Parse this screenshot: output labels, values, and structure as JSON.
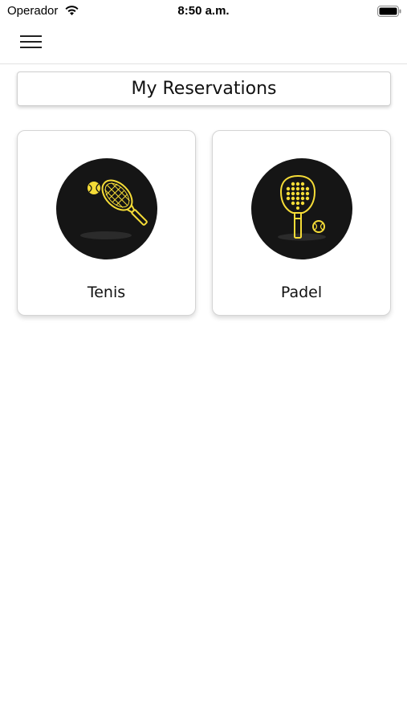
{
  "status_bar": {
    "carrier": "Operador",
    "time": "8:50 a.m.",
    "wifi_icon": "wifi-icon",
    "battery_icon": "battery-full-icon"
  },
  "nav": {
    "menu_icon": "hamburger-menu-icon"
  },
  "page": {
    "title": "My Reservations"
  },
  "sports": [
    {
      "label": "Tenis",
      "icon": "tennis-racket-icon"
    },
    {
      "label": "Padel",
      "icon": "padel-racket-icon"
    }
  ],
  "colors": {
    "icon_accent": "#f5dc37",
    "icon_background": "#151515",
    "text": "#111111"
  }
}
